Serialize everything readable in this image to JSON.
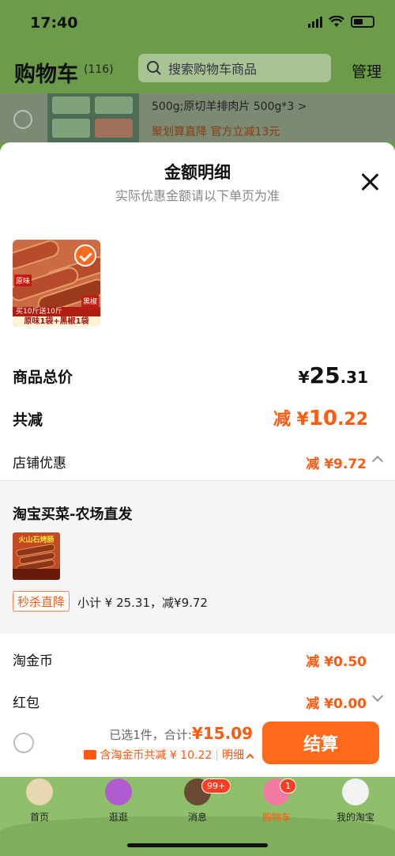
{
  "status": {
    "time": "17:40"
  },
  "header": {
    "title": "购物车",
    "count": "(116)",
    "search_placeholder": "搜索购物车商品",
    "manage": "管理"
  },
  "bg_item": {
    "spec": "500g;原切羊排肉片 500g*3 >",
    "promo": "聚划算直降    官方立减13元"
  },
  "sheet": {
    "title": "金额明细",
    "subtitle": "实际优惠金额请以下单页为准",
    "product": {
      "tag_left": "原味",
      "tag_right": "黑椒",
      "band1": "买10斤送10斤",
      "band2": "原味1袋+黑椒1袋"
    },
    "total_label": "商品总价",
    "total_yen": "¥",
    "total_int": "25",
    "total_dec": ".31",
    "reduce_label": "共减",
    "reduce_prefix": "减 ¥",
    "reduce_int": "10",
    "reduce_dec": ".22",
    "shop_label": "店铺优惠",
    "shop_value": "减 ¥9.72",
    "shop": {
      "name": "淘宝买菜-农场直发",
      "thumb_title": "火山石烤肠",
      "badge": "秒杀直降",
      "subtotal": "小计 ¥ 25.31，减¥9.72"
    },
    "coin_label": "淘金币",
    "coin_value": "减 ¥0.50",
    "hongbao_label": "红包",
    "hongbao_value": "减 ¥0.00"
  },
  "checkout": {
    "selected": "已选1件，合计:",
    "amount_yen": "¥",
    "amount": "15.09",
    "discount": "含淘金币共减 ¥ 10.22",
    "detail": "明细",
    "pay": "结算"
  },
  "tabbar": {
    "items": [
      {
        "label": "首页"
      },
      {
        "label": "逛逛"
      },
      {
        "label": "消息",
        "badge": "99+"
      },
      {
        "label": "购物车",
        "badge": "1"
      },
      {
        "label": "我的淘宝"
      }
    ]
  },
  "colors": {
    "accent": "#ff5a10",
    "header_green": "#6c9b4a",
    "tab_green": "#8fbf6a"
  }
}
